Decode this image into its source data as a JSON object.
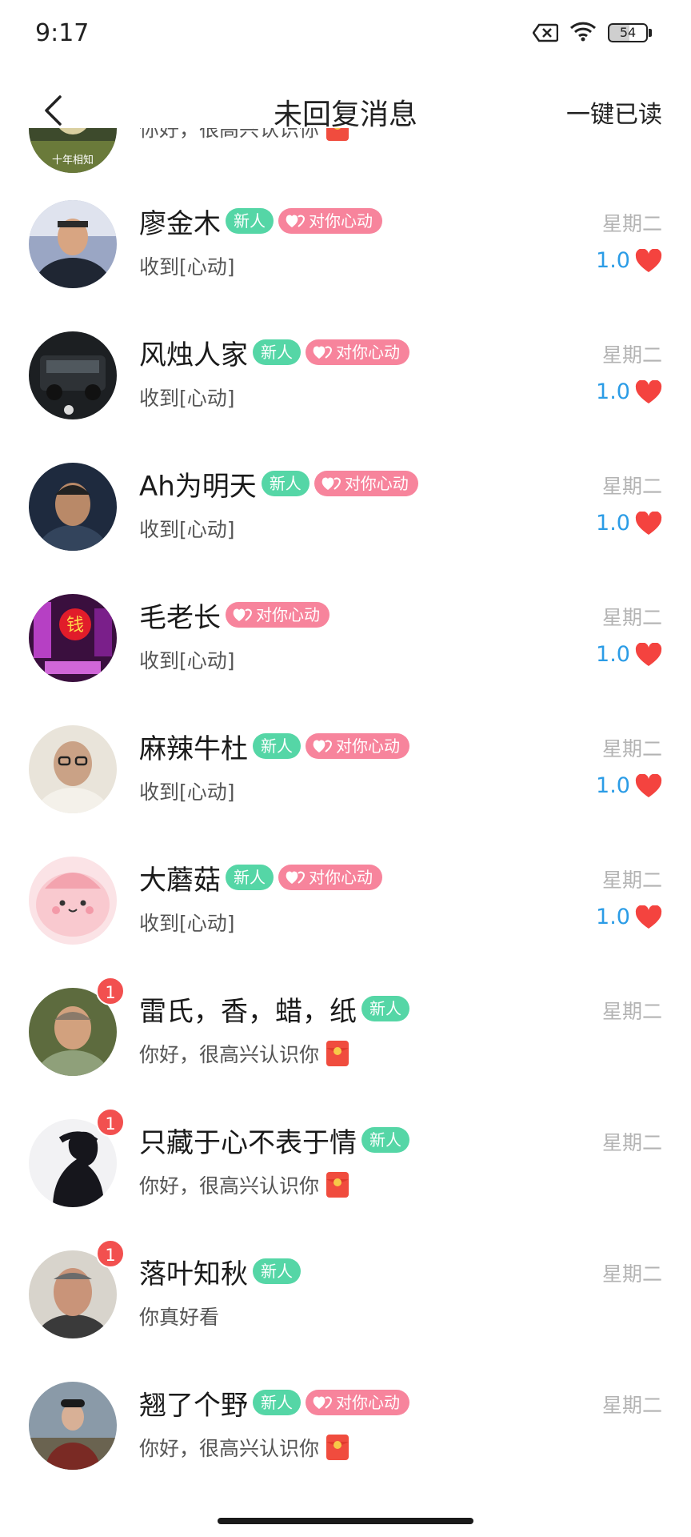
{
  "status_bar": {
    "time": "9:17",
    "battery": "54"
  },
  "header": {
    "title": "未回复消息",
    "read_all": "一键已读"
  },
  "partial_item": {
    "message": "你好，很高兴认识你",
    "avatar_text": "十年相知"
  },
  "items": [
    {
      "name": "廖金木",
      "tags": {
        "new": "新人",
        "heart": "对你心动"
      },
      "message": "收到[心动]",
      "time": "星期二",
      "score": "1.0"
    },
    {
      "name": "风烛人家",
      "tags": {
        "new": "新人",
        "heart": "对你心动"
      },
      "message": "收到[心动]",
      "time": "星期二",
      "score": "1.0"
    },
    {
      "name": "Ah为明天",
      "tags": {
        "new": "新人",
        "heart": "对你心动"
      },
      "message": "收到[心动]",
      "time": "星期二",
      "score": "1.0"
    },
    {
      "name": "毛老长",
      "tags": {
        "heart": "对你心动"
      },
      "message": "收到[心动]",
      "time": "星期二",
      "score": "1.0",
      "avatar_text": "钱"
    },
    {
      "name": "麻辣牛杜",
      "tags": {
        "new": "新人",
        "heart": "对你心动"
      },
      "message": "收到[心动]",
      "time": "星期二",
      "score": "1.0"
    },
    {
      "name": "大蘑菇",
      "tags": {
        "new": "新人",
        "heart": "对你心动"
      },
      "message": "收到[心动]",
      "time": "星期二",
      "score": "1.0"
    },
    {
      "name": "雷氏，香，蜡，纸",
      "tags": {
        "new": "新人"
      },
      "message": "你好，很高兴认识你",
      "time": "星期二",
      "badge": "1"
    },
    {
      "name": "只藏于心不表于情",
      "tags": {
        "new": "新人"
      },
      "message": "你好，很高兴认识你",
      "time": "星期二",
      "badge": "1"
    },
    {
      "name": "落叶知秋",
      "tags": {
        "new": "新人"
      },
      "message": "你真好看",
      "time": "星期二",
      "badge": "1"
    },
    {
      "name": "翘了个野",
      "tags": {
        "new": "新人",
        "heart": "对你心动"
      },
      "message": "你好，很高兴认识你",
      "time": "星期二"
    }
  ]
}
